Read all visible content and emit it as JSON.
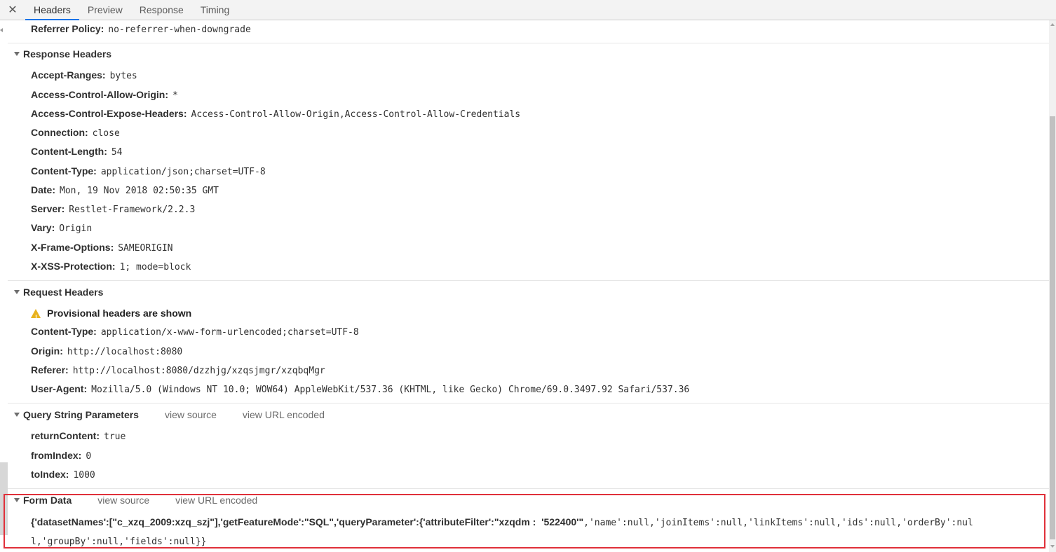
{
  "tabbar": {
    "tabs": [
      {
        "label": "Headers",
        "active": true
      },
      {
        "label": "Preview",
        "active": false
      },
      {
        "label": "Response",
        "active": false
      },
      {
        "label": "Timing",
        "active": false
      }
    ],
    "close_glyph": "✕",
    "active_color": "#1a73e8"
  },
  "general": {
    "referrer_policy": {
      "key": "Referrer Policy:",
      "value": "no-referrer-when-downgrade"
    }
  },
  "response_headers": {
    "title": "Response Headers",
    "rows": [
      {
        "key": "Accept-Ranges:",
        "value": "bytes"
      },
      {
        "key": "Access-Control-Allow-Origin:",
        "value": "*"
      },
      {
        "key": "Access-Control-Expose-Headers:",
        "value": "Access-Control-Allow-Origin,Access-Control-Allow-Credentials"
      },
      {
        "key": "Connection:",
        "value": "close"
      },
      {
        "key": "Content-Length:",
        "value": "54"
      },
      {
        "key": "Content-Type:",
        "value": "application/json;charset=UTF-8"
      },
      {
        "key": "Date:",
        "value": "Mon, 19 Nov 2018 02:50:35 GMT"
      },
      {
        "key": "Server:",
        "value": "Restlet-Framework/2.2.3"
      },
      {
        "key": "Vary:",
        "value": "Origin"
      },
      {
        "key": "X-Frame-Options:",
        "value": "SAMEORIGIN"
      },
      {
        "key": "X-XSS-Protection:",
        "value": "1; mode=block"
      }
    ]
  },
  "request_headers": {
    "title": "Request Headers",
    "warning": "Provisional headers are shown",
    "warning_icon": "warning-triangle-icon",
    "warning_color": "#e8b21e",
    "rows": [
      {
        "key": "Content-Type:",
        "value": "application/x-www-form-urlencoded;charset=UTF-8"
      },
      {
        "key": "Origin:",
        "value": "http://localhost:8080"
      },
      {
        "key": "Referer:",
        "value": "http://localhost:8080/dzzhjg/xzqsjmgr/xzqbqMgr"
      },
      {
        "key": "User-Agent:",
        "value": "Mozilla/5.0 (Windows NT 10.0; WOW64) AppleWebKit/537.36 (KHTML, like Gecko) Chrome/69.0.3497.92 Safari/537.36"
      }
    ]
  },
  "query_params": {
    "title": "Query String Parameters",
    "view_source": "view source",
    "view_url_encoded": "view URL encoded",
    "rows": [
      {
        "key": "returnContent:",
        "value": "true"
      },
      {
        "key": "fromIndex:",
        "value": "0"
      },
      {
        "key": "toIndex:",
        "value": "1000"
      }
    ]
  },
  "form_data": {
    "title": "Form Data",
    "view_source": "view source",
    "view_url_encoded": "view URL encoded",
    "highlight_color": "#e0303a",
    "line1_bold": "{'datasetNames':[\"c_xzq_2009:xzq_szj\"],'getFeatureMode':\"SQL\",'queryParameter':{'attributeFilter':\"xzqdm :  '522400'\"",
    "line1_mono": ",'name':null,'joinItems':null,'linkItems':null,'ids':null,'orderBy':nul",
    "line2_mono": "l,'groupBy':null,'fields':null}}"
  }
}
